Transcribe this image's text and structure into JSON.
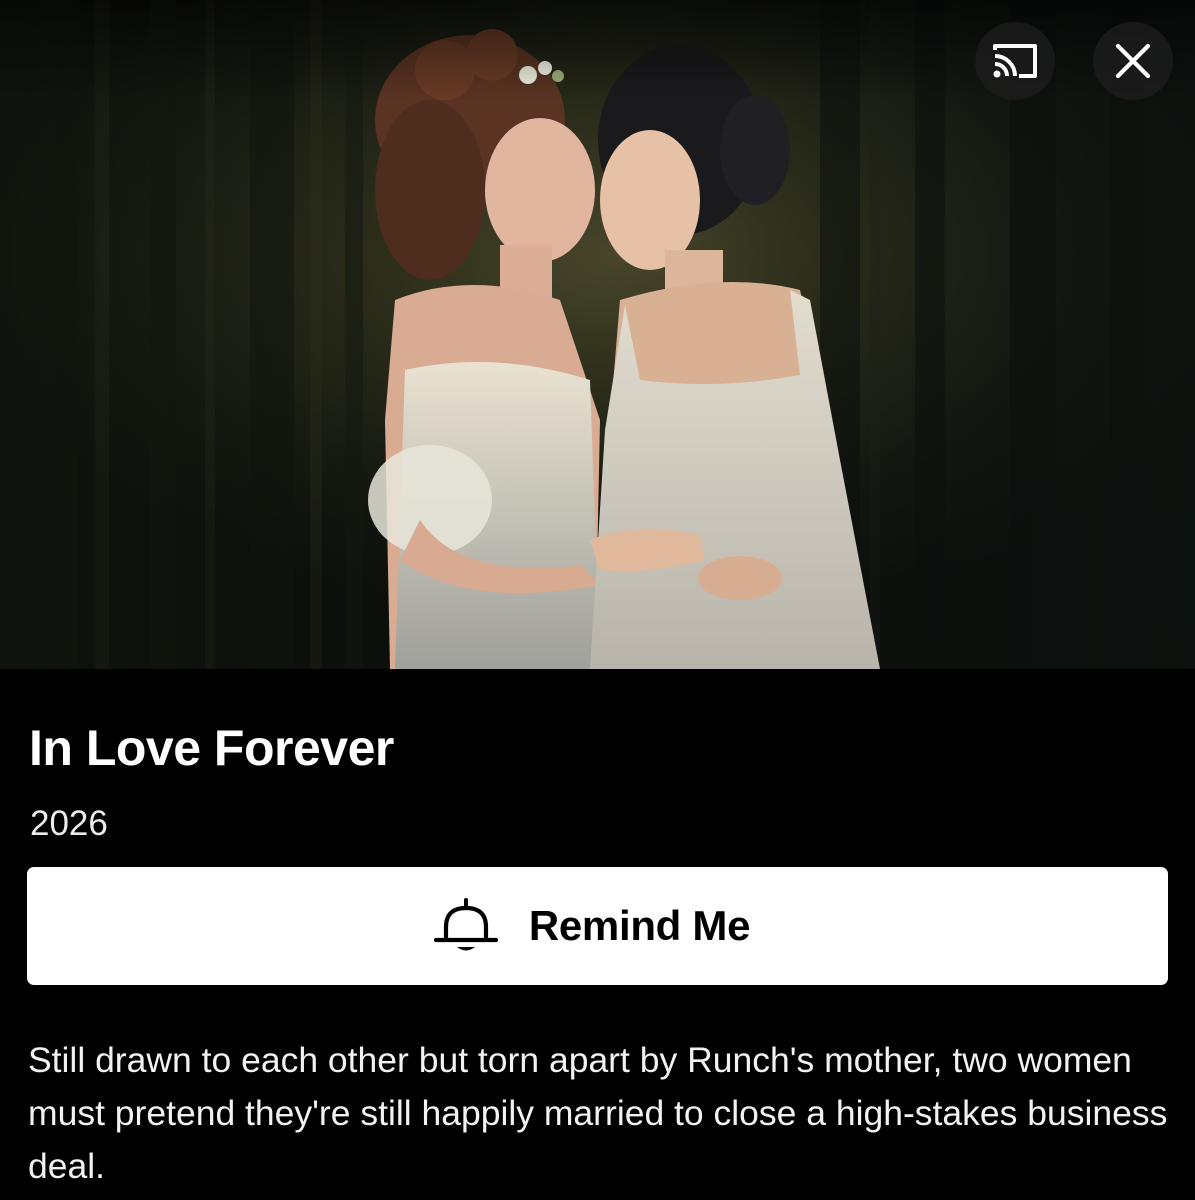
{
  "hero": {
    "controls": {
      "cast_icon": "cast-icon",
      "close_icon": "close-icon"
    }
  },
  "details": {
    "title": "In Love Forever",
    "year": "2026",
    "remind_button": {
      "icon": "bell-icon",
      "label": "Remind Me"
    },
    "synopsis": "Still drawn to each other but torn apart by Runch's mother, two women must pretend they're still happily married to close a high-stakes business deal."
  },
  "colors": {
    "background": "#000000",
    "text": "#ffffff",
    "button_bg": "#ffffff",
    "button_text": "#000000",
    "overlay_button": "#1c1c1c"
  }
}
